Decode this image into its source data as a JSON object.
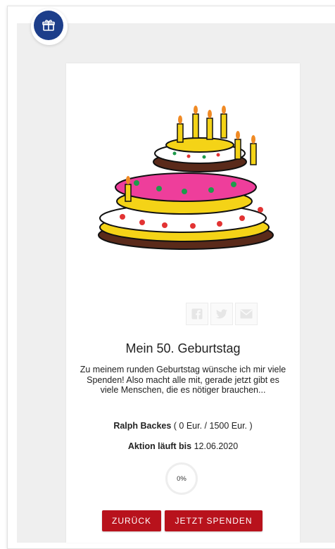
{
  "header": {
    "badge_icon": "gift-icon",
    "accent": "#1d3e8a"
  },
  "campaign": {
    "title": "Mein 50. Geburtstag",
    "description": "Zu meinem runden Geburtstag wünsche ich mir viele Spenden! Also macht alle mit, gerade jetzt gibt es viele Menschen, die es nötiger brauchen...",
    "owner_name": "Ralph Backes",
    "amount_text": " ( 0 Eur. / 1500 Eur. )",
    "end_label": "Aktion läuft bis",
    "end_date": " 12.06.2020",
    "progress_label": "0%",
    "progress_fraction": 0
  },
  "share": {
    "icons": [
      "facebook-icon",
      "twitter-icon",
      "mail-icon"
    ]
  },
  "buttons": {
    "back_label": "ZURÜCK",
    "donate_label": "JETZT SPENDEN",
    "color": "#b8121c"
  }
}
